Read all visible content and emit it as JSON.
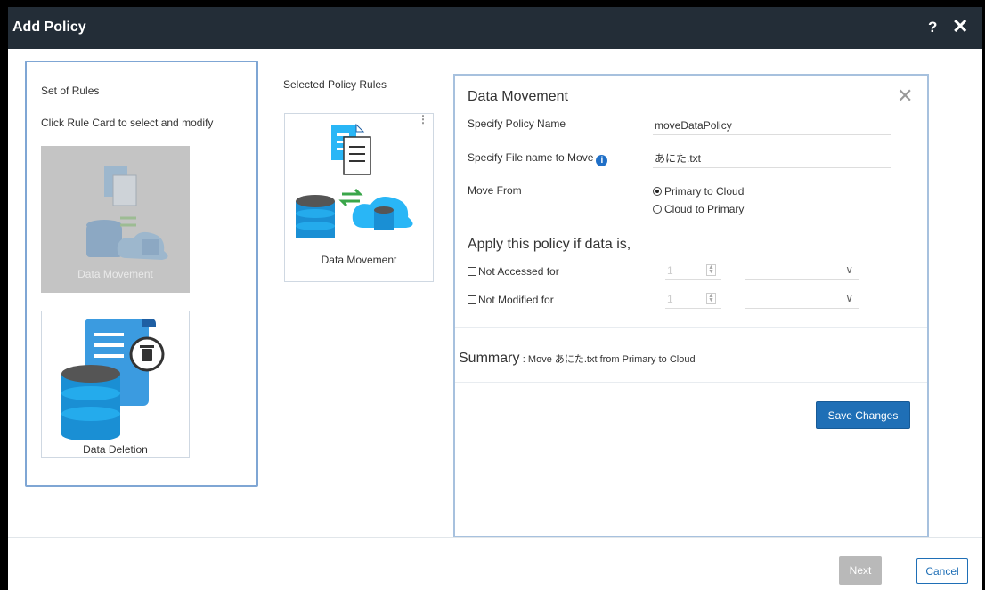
{
  "dialog": {
    "title": "Add Policy",
    "help_label": "?",
    "close_label": "✕"
  },
  "rules_panel": {
    "heading": "Set of Rules",
    "instruction": "Click Rule Card to select and modify",
    "cards": [
      {
        "label": "Data Movement",
        "state": "disabled",
        "icon": "data-movement-icon"
      },
      {
        "label": "Data Deletion",
        "state": "enabled",
        "icon": "data-deletion-icon"
      }
    ]
  },
  "selected": {
    "heading": "Selected Policy Rules",
    "card_label": "Data Movement",
    "menu_label": "⋮"
  },
  "detail": {
    "title": "Data Movement",
    "close_label": "✕",
    "policy_name_label": "Specify Policy Name",
    "policy_name_value": "moveDataPolicy",
    "file_name_label": "Specify File name to Move",
    "file_name_value": "あにた.txt",
    "move_from_label": "Move From",
    "move_options": [
      {
        "label": "Primary to Cloud",
        "selected": true
      },
      {
        "label": "Cloud to Primary",
        "selected": false
      }
    ],
    "apply_heading": "Apply this policy if data is,",
    "conditions": [
      {
        "label": "Not Accessed for",
        "value": "1",
        "checked": false
      },
      {
        "label": "Not Modified for",
        "value": "1",
        "checked": false
      }
    ],
    "summary_label": "Summary",
    "summary_text": ": Move あにた.txt from Primary to Cloud",
    "save_label": "Save Changes"
  },
  "footer": {
    "next_label": "Next",
    "cancel_label": "Cancel"
  },
  "colors": {
    "titlebar": "#232d37",
    "primary": "#1f6fb6",
    "panel_border": "#7fa6d4",
    "disabled_card": "#c4c4c4"
  }
}
